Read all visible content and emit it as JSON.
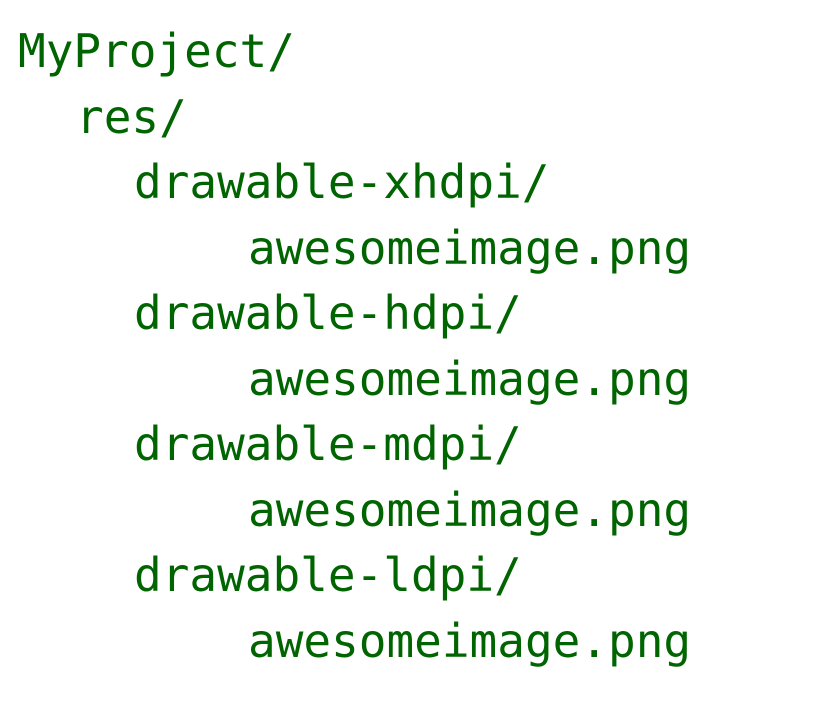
{
  "text_color": "#006400",
  "background": "#ffffff",
  "tree": {
    "root": "MyProject/",
    "res": "res/",
    "folders": [
      {
        "name": "drawable-xhdpi/",
        "file": "awesomeimage.png"
      },
      {
        "name": "drawable-hdpi/",
        "file": "awesomeimage.png"
      },
      {
        "name": "drawable-mdpi/",
        "file": "awesomeimage.png"
      },
      {
        "name": "drawable-ldpi/",
        "file": "awesomeimage.png"
      }
    ]
  }
}
